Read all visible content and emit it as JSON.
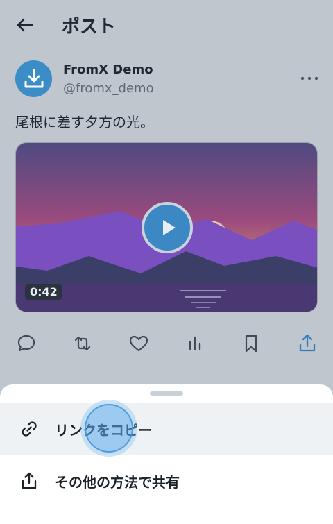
{
  "header": {
    "title": "ポスト",
    "back_icon": "arrow-left-icon"
  },
  "post": {
    "author_name": "FromX Demo",
    "author_handle": "@fromx_demo",
    "avatar_icon": "download-icon",
    "text": "尾根に差す夕方の光。",
    "media": {
      "type": "video",
      "duration": "0:42"
    }
  },
  "actions": [
    "reply-icon",
    "repost-icon",
    "like-icon",
    "views-icon",
    "bookmark-icon",
    "share-icon"
  ],
  "sheet": {
    "options": [
      {
        "label": "リンクをコピー",
        "icon": "link-icon"
      },
      {
        "label": "その他の方法で共有",
        "icon": "share-icon"
      }
    ]
  },
  "colors": {
    "accent": "#3a8dc6",
    "background": "#bfc6ce",
    "sheet": "#ffffff"
  }
}
